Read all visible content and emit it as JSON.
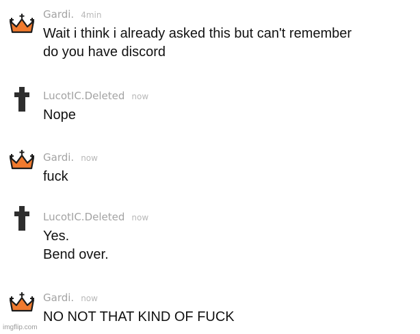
{
  "messages": [
    {
      "author": "Gardi.",
      "time": "4min",
      "avatar": "crown-icon",
      "lines": [
        "Wait i think i already asked this but can't remember",
        "do you have discord"
      ]
    },
    {
      "author": "LucotIC.Deleted",
      "time": "now",
      "avatar": "cross-icon",
      "lines": [
        "Nope"
      ]
    },
    {
      "author": "Gardi.",
      "time": "now",
      "avatar": "crown-icon",
      "lines": [
        "fuck"
      ]
    },
    {
      "author": "LucotIC.Deleted",
      "time": "now",
      "avatar": "cross-icon",
      "lines": [
        "Yes.",
        "Bend over."
      ]
    },
    {
      "author": "Gardi.",
      "time": "now",
      "avatar": "crown-icon",
      "lines": [
        "NO NOT THAT KIND OF FUCK"
      ]
    }
  ],
  "watermark": "imgflip.com",
  "colors": {
    "crown_fill": "#f07a2e",
    "cross_fill": "#2e2e2e",
    "author_text": "#a3a3a3",
    "message_text": "#111111"
  }
}
